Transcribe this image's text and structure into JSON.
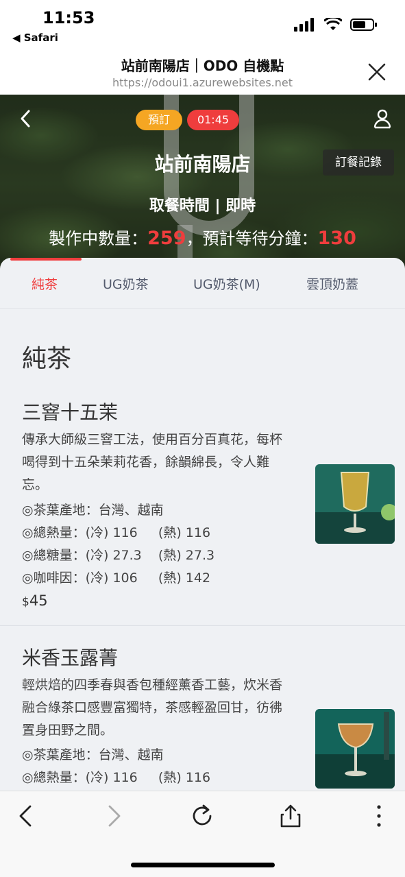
{
  "status_bar": {
    "time": "11:53",
    "back_app": "◀ Safari"
  },
  "browser": {
    "title": "站前南陽店｜ODO 自機點",
    "url": "https://odoui1.azurewebsites.net"
  },
  "hero": {
    "badge_preorder": "預訂",
    "badge_time": "01:45",
    "store_name": "站前南陽店",
    "order_record_label": "訂餐記錄",
    "pickup_text": "取餐時間 | 即時",
    "queue_prefix": "製作中數量：",
    "queue_count": "259",
    "queue_middle": "，預計等待分鐘：",
    "queue_wait": "130"
  },
  "tabs": [
    {
      "label": "純茶",
      "active": true
    },
    {
      "label": "UG奶茶",
      "active": false
    },
    {
      "label": "UG奶茶(M)",
      "active": false
    },
    {
      "label": "雲頂奶蓋",
      "active": false
    }
  ],
  "section": {
    "title": "純茶"
  },
  "items": [
    {
      "name": "三窨十五茉",
      "desc": "傳承大師級三窨工法，使用百分百真花，每杯喝得到十五朵茉莉花香，餘韻綿長，令人難忘。",
      "origin": "◎茶葉產地：台灣、越南",
      "calories": "◎總熱量：(冷) 116     (熱) 116",
      "sugar": "◎總糖量：(冷) 27.3    (熱) 27.3",
      "caffeine": "◎咖啡因：(冷) 106     (熱) 142",
      "currency": "$",
      "price": "45"
    },
    {
      "name": "米香玉露菁",
      "desc": "輕烘焙的四季春與香包種經薰香工藝，炊米香融合綠茶口感豐富獨特，茶感輕盈回甘，彷彿置身田野之間。",
      "origin": "◎茶葉產地：台灣、越南",
      "calories": "◎總熱量：(冷) 116     (熱) 116"
    }
  ],
  "colors": {
    "accent_red": "#ef3d3d",
    "accent_orange": "#f5a623",
    "content_bg": "#eff1f4"
  },
  "icons": {
    "back": "chevron-left-icon",
    "forward": "chevron-right-icon",
    "reload": "reload-icon",
    "share": "share-icon",
    "more": "more-vertical-icon",
    "close": "close-icon",
    "user": "user-icon"
  }
}
